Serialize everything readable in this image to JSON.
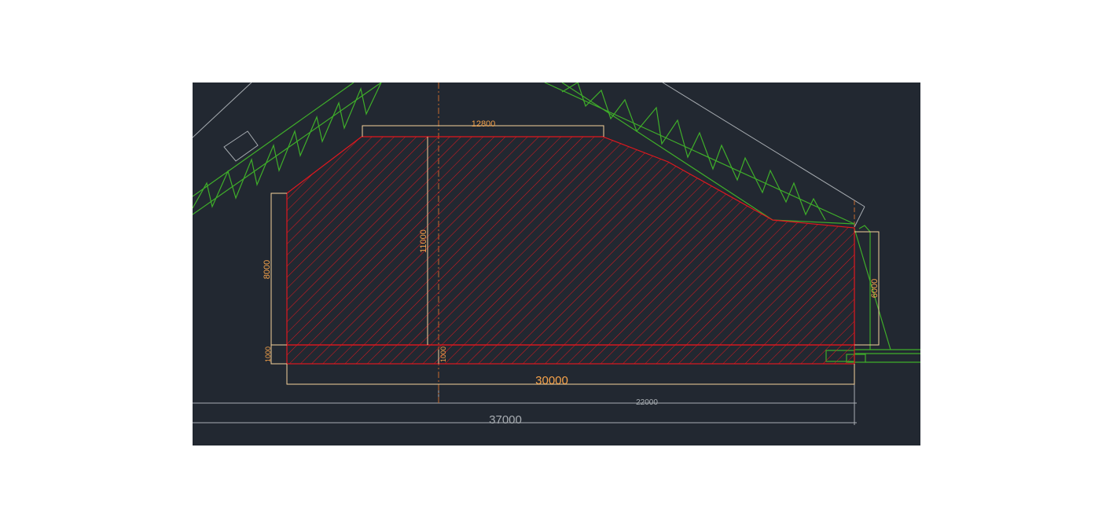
{
  "colors": {
    "background": "#222831",
    "page": "#ffffff",
    "hatch_region": "#e1171e",
    "dimension_lines": "#f5d29a",
    "dimension_text": "#f5a24a",
    "truss": "#3fae2a",
    "gray_lines": "#a8adb2",
    "center_line": "#c56a2d"
  },
  "dimensions": {
    "top_width": "12800",
    "left_height": "8000",
    "center_height": "11000",
    "right_height": "6000",
    "left_strip": "1000",
    "center_strip": "1000",
    "bottom_width": "30000",
    "outer_right": "22000",
    "outer_total": "37000"
  }
}
